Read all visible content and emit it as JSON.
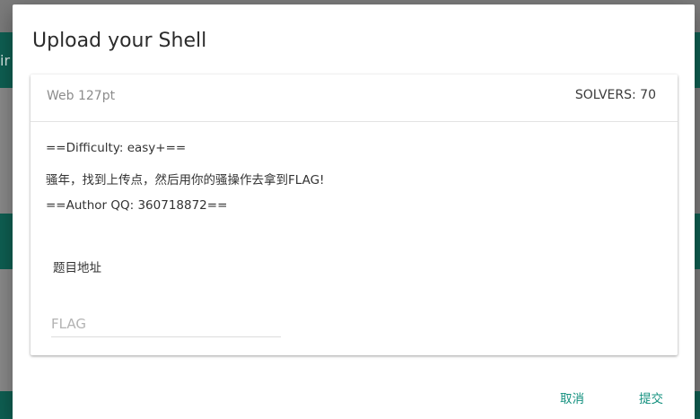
{
  "background": {
    "fragment_text": "ir"
  },
  "modal": {
    "title": "Upload your Shell",
    "challenge": {
      "category": "Web 127pt",
      "solvers": "SOLVERS: 70",
      "description": [
        "==Difficulty: easy+==",
        "骚年，找到上传点，然后用你的骚操作去拿到FLAG!",
        "==Author QQ: 360718872=="
      ],
      "link_label": "题目地址",
      "flag_placeholder": "FLAG",
      "flag_value": ""
    },
    "actions": {
      "cancel_label": "取消",
      "submit_label": "提交"
    }
  },
  "colors": {
    "accent": "#12907e",
    "overlay_teal": "#0e5f52"
  }
}
